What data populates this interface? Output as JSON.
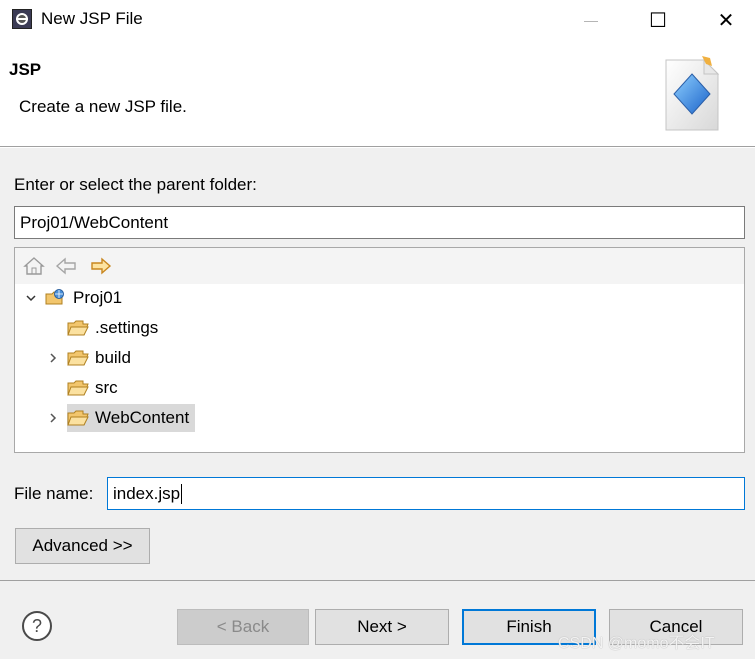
{
  "window": {
    "title": "New JSP File",
    "minimize_label": "—",
    "maximize_label": "☐",
    "close_label": "✕"
  },
  "banner": {
    "title": "JSP",
    "description": "Create a new JSP file."
  },
  "folder": {
    "label": "Enter or select the parent folder:",
    "value": "Proj01/WebContent"
  },
  "tree": {
    "project": "Proj01",
    "items": [
      {
        "label": ".settings",
        "expandable": false
      },
      {
        "label": "build",
        "expandable": true
      },
      {
        "label": "src",
        "expandable": false
      },
      {
        "label": "WebContent",
        "expandable": true,
        "selected": true
      }
    ]
  },
  "file_name": {
    "label": "File name:",
    "value": "index.jsp"
  },
  "buttons": {
    "advanced": "Advanced >>",
    "back": "< Back",
    "next": "Next >",
    "finish": "Finish",
    "cancel": "Cancel"
  },
  "watermark": "CSDN @momo不会IT",
  "colors": {
    "accent": "#0078d7",
    "folder": "#f2c66d",
    "selection": "#d9d9d9"
  }
}
